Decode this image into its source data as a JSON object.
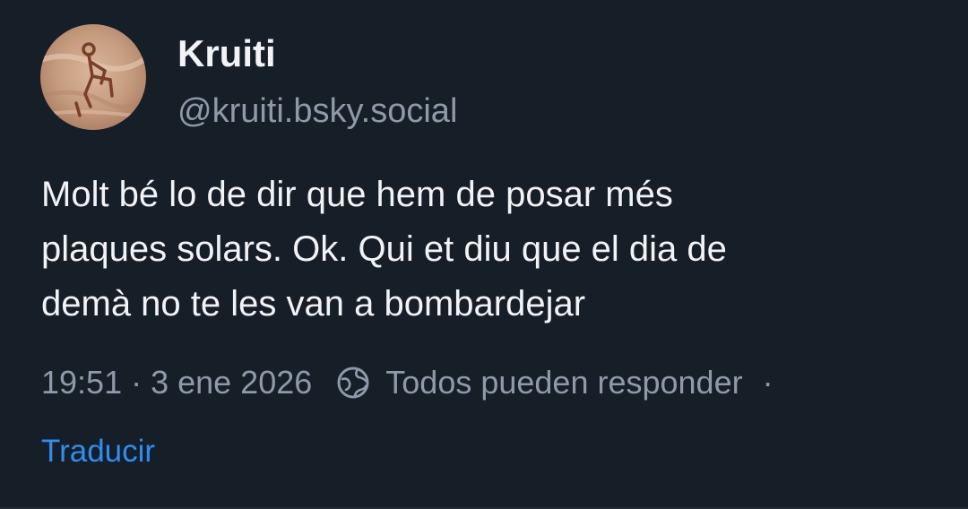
{
  "author": {
    "display_name": "Kruiti",
    "handle": "@kruiti.bsky.social",
    "avatar_icon": "avatar-image"
  },
  "post": {
    "text": "Molt bé lo de dir que hem de posar més\nplaques solars. Ok. Qui et diu que el dia de\ndemà no te les van a bombardejar"
  },
  "meta": {
    "timestamp": "19:51",
    "separator": "·",
    "date": "3 ene 2026",
    "reply_icon": "globe-icon",
    "reply_setting": "Todos pueden responder",
    "more_dot": "·"
  },
  "actions": {
    "translate": "Traducir"
  },
  "colors": {
    "background": "#161e27",
    "text": "#f1f3f5",
    "muted": "#8d9aaa",
    "link": "#2f8cf0"
  }
}
